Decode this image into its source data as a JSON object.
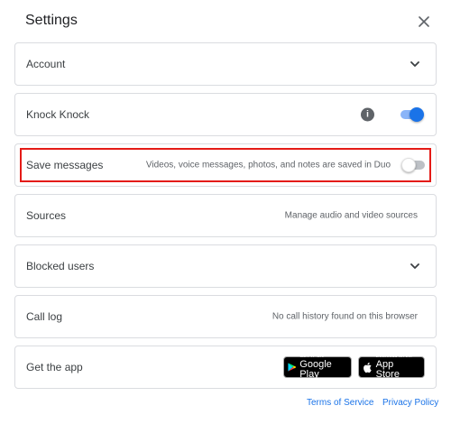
{
  "dialog": {
    "title": "Settings"
  },
  "rows": {
    "account": {
      "label": "Account"
    },
    "knock_knock": {
      "label": "Knock Knock",
      "enabled": true,
      "info_glyph": "i"
    },
    "save_messages": {
      "label": "Save messages",
      "description": "Videos, voice messages, photos, and notes are saved in Duo",
      "enabled": false
    },
    "sources": {
      "label": "Sources",
      "description": "Manage audio and video sources"
    },
    "blocked_users": {
      "label": "Blocked users"
    },
    "call_log": {
      "label": "Call log",
      "description": "No call history found on this browser"
    },
    "get_app": {
      "label": "Get the app",
      "google_play": {
        "small": "GET IT ON",
        "big": "Google Play"
      },
      "app_store": {
        "small": "Download on the",
        "big": "App Store"
      }
    }
  },
  "footer": {
    "terms": "Terms of Service",
    "privacy": "Privacy Policy"
  },
  "colors": {
    "accent": "#1a73e8",
    "highlight_border": "#e41b17",
    "row_border": "#dadce0"
  },
  "icons": {
    "close": "close-icon",
    "chevron": "chevron-down-icon",
    "info": "info-icon",
    "google_play": "google-play-icon",
    "apple": "apple-icon"
  }
}
